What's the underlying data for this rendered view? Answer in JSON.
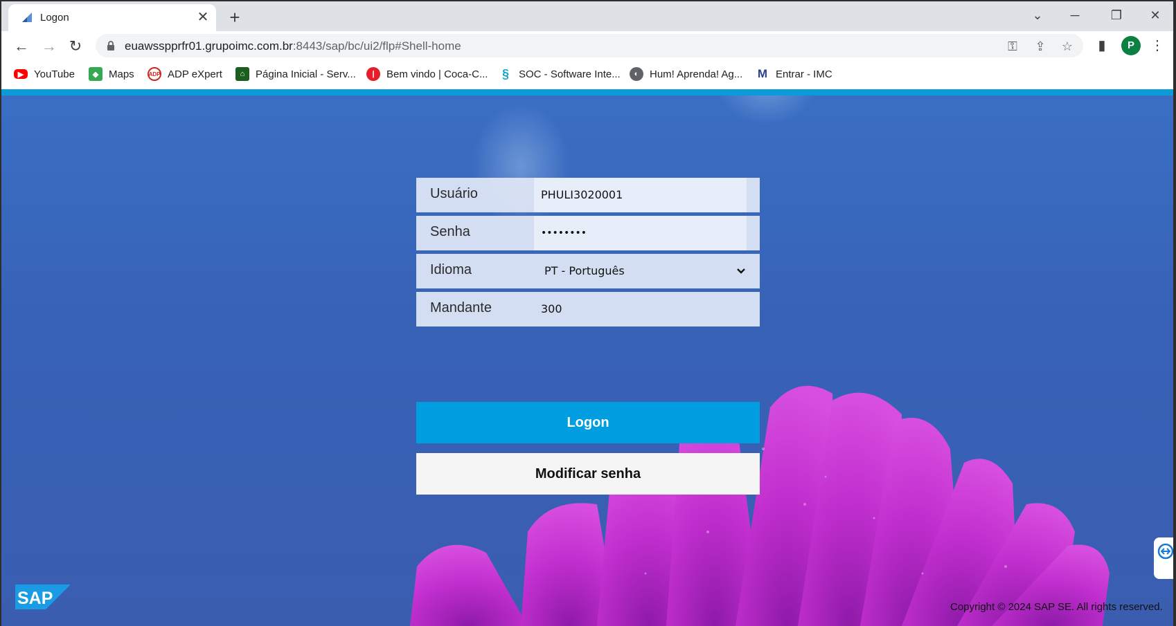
{
  "browser": {
    "tab": {
      "title": "Logon"
    },
    "url": {
      "host": "euawsspprfr01.grupoimc.com.br",
      "rest": ":8443/sap/bc/ui2/flp#Shell-home"
    },
    "profile_initial": "P",
    "bookmarks": [
      {
        "label": "YouTube",
        "icon": "youtube-icon"
      },
      {
        "label": "Maps",
        "icon": "maps-icon"
      },
      {
        "label": "ADP eXpert",
        "icon": "adp-icon"
      },
      {
        "label": "Página Inicial - Serv...",
        "icon": "page-icon"
      },
      {
        "label": "Bem vindo | Coca-C...",
        "icon": "coca-cola-icon"
      },
      {
        "label": "SOC - Software Inte...",
        "icon": "soc-icon"
      },
      {
        "label": "Hum! Aprenda! Ag...",
        "icon": "globe-icon"
      },
      {
        "label": "Entrar - IMC",
        "icon": "imc-icon"
      }
    ]
  },
  "logon": {
    "user_label": "Usuário",
    "user_value": "PHULI3020001",
    "password_label": "Senha",
    "password_value": "••••••••",
    "language_label": "Idioma",
    "language_value": "PT - Português",
    "client_label": "Mandante",
    "client_value": "300",
    "logon_button": "Logon",
    "change_password_button": "Modificar senha"
  },
  "footer": {
    "copyright": "Copyright © 2024 SAP SE. All rights reserved."
  },
  "colors": {
    "accent": "#009de0",
    "background": "#3a64b8",
    "flower": "#c22fcf"
  }
}
